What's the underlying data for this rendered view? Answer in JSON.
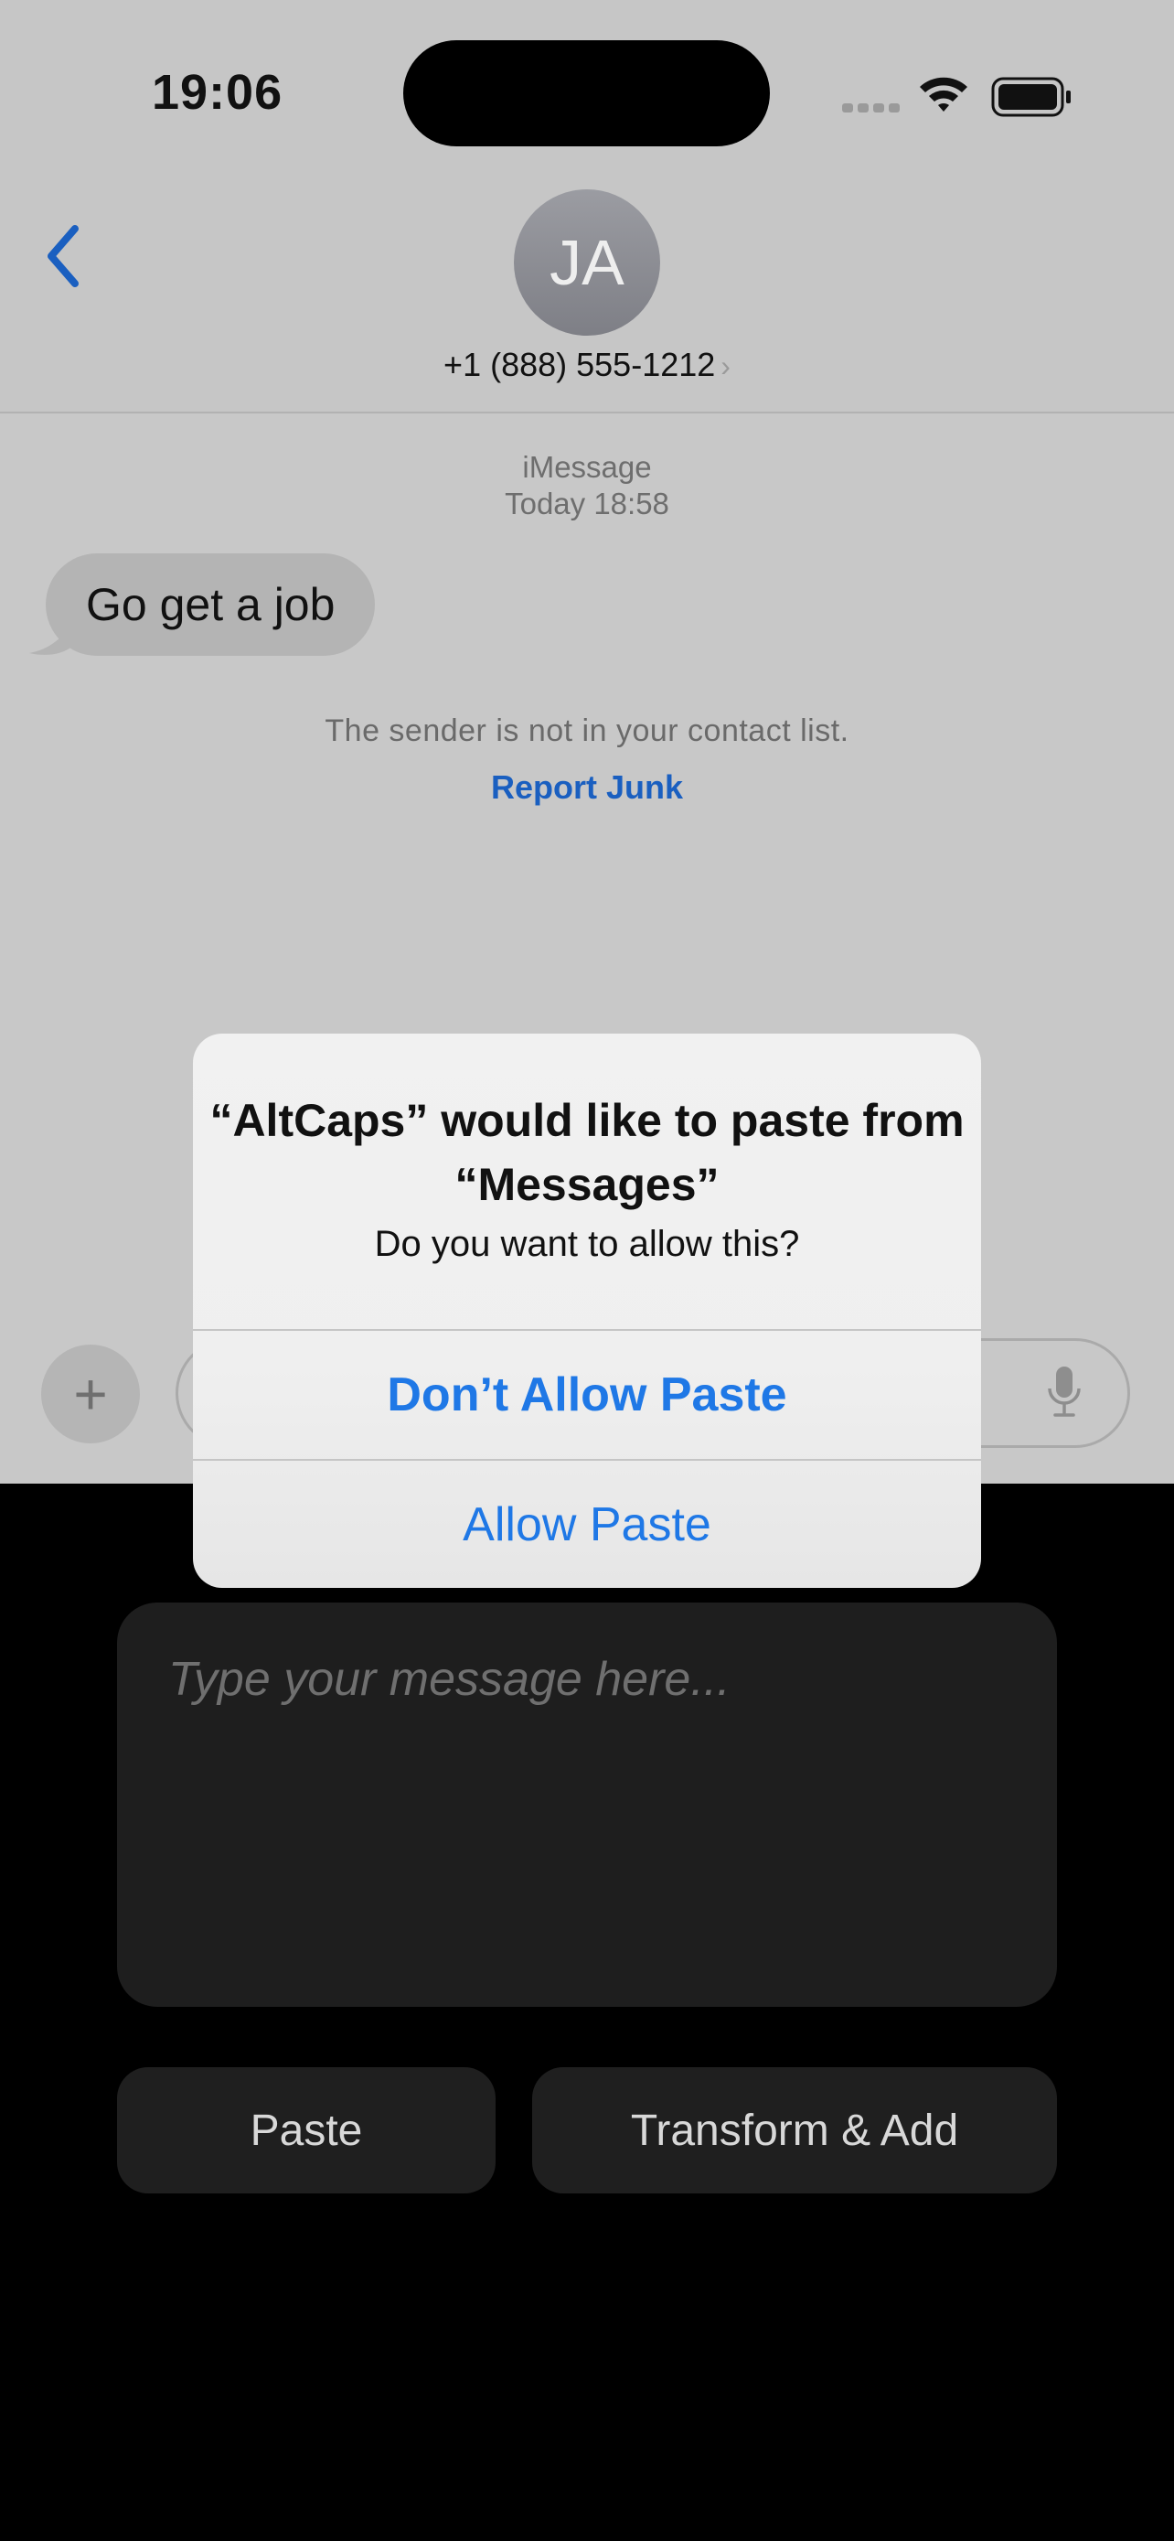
{
  "status_bar": {
    "time": "19:06"
  },
  "conversation": {
    "avatar_initials": "JA",
    "contact_number": "+1 (888) 555-1212",
    "service": "iMessage",
    "timestamp": "Today 18:58",
    "messages": [
      {
        "text": "Go get a job",
        "direction": "incoming"
      }
    ],
    "sender_note": "The sender is not in your contact list.",
    "report_junk": "Report Junk"
  },
  "extension": {
    "placeholder": "Type your message here...",
    "paste_label": "Paste",
    "transform_label": "Transform & Add"
  },
  "alert": {
    "title": "“AltCaps” would like to paste from “Messages”",
    "message": "Do you want to allow this?",
    "dont_allow": "Don’t Allow Paste",
    "allow": "Allow Paste"
  },
  "colors": {
    "accent": "#1f78e6",
    "link": "#1a5fc0"
  }
}
